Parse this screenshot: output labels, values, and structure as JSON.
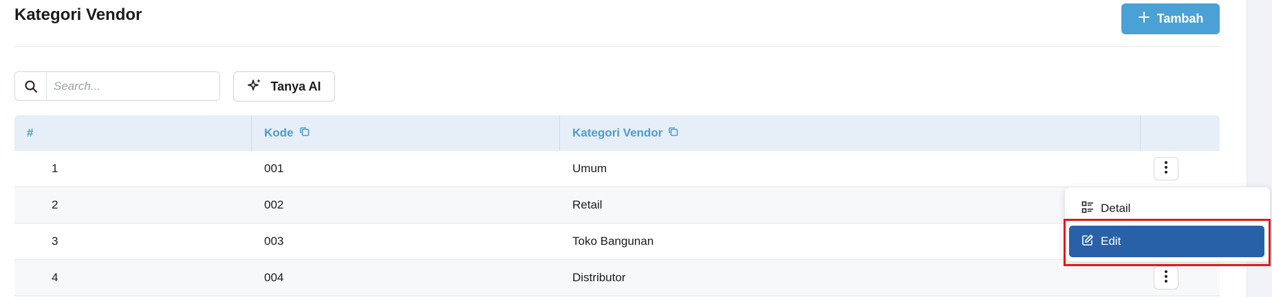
{
  "header": {
    "title": "Kategori Vendor",
    "add_button_label": "Tambah"
  },
  "toolbar": {
    "search_placeholder": "Search...",
    "search_value": "",
    "ai_button_label": "Tanya AI"
  },
  "table": {
    "columns": {
      "num": "#",
      "kode": "Kode",
      "kategori": "Kategori Vendor"
    },
    "rows": [
      {
        "num": "1",
        "kode": "001",
        "kategori": "Umum"
      },
      {
        "num": "2",
        "kode": "002",
        "kategori": "Retail"
      },
      {
        "num": "3",
        "kode": "003",
        "kategori": "Toko Bangunan"
      },
      {
        "num": "4",
        "kode": "004",
        "kategori": "Distributor"
      }
    ]
  },
  "row_menu": {
    "detail_label": "Detail",
    "edit_label": "Edit"
  },
  "colors": {
    "primary_button": "#4aa1d6",
    "header_text": "#4a9ccf",
    "table_header_bg": "#e6eef8",
    "menu_active_bg": "#2861a8",
    "highlight_border": "#e3161c"
  },
  "icons": {
    "add": "plus-icon",
    "search": "search-icon",
    "ai": "sparkles-icon",
    "copy": "copy-icon",
    "row_actions": "kebab-vertical-icon",
    "detail": "detail-list-icon",
    "edit": "edit-icon"
  }
}
